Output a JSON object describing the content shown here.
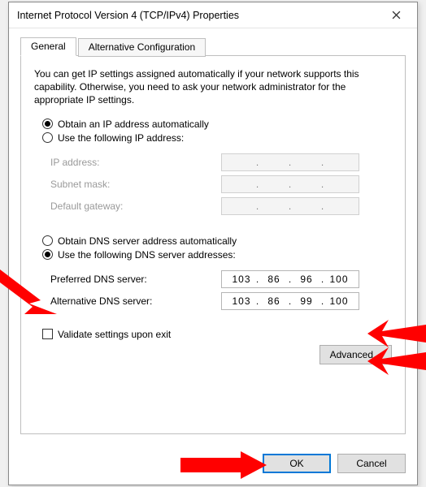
{
  "window": {
    "title": "Internet Protocol Version 4 (TCP/IPv4) Properties"
  },
  "tabs": {
    "general": "General",
    "alt": "Alternative Configuration"
  },
  "description": "You can get IP settings assigned automatically if your network supports this capability. Otherwise, you need to ask your network administrator for the appropriate IP settings.",
  "ip_section": {
    "auto_label": "Obtain an IP address automatically",
    "manual_label": "Use the following IP address:",
    "fields": {
      "ip_address": {
        "label": "IP address:",
        "value": ""
      },
      "subnet_mask": {
        "label": "Subnet mask:",
        "value": ""
      },
      "gateway": {
        "label": "Default gateway:",
        "value": ""
      }
    }
  },
  "dns_section": {
    "auto_label": "Obtain DNS server address automatically",
    "manual_label": "Use the following DNS server addresses:",
    "preferred": {
      "label": "Preferred DNS server:",
      "o1": "103",
      "o2": "86",
      "o3": "96",
      "o4": "100"
    },
    "alternate": {
      "label": "Alternative DNS server:",
      "o1": "103",
      "o2": "86",
      "o3": "99",
      "o4": "100"
    }
  },
  "validate_label": "Validate settings upon exit",
  "buttons": {
    "advanced": "Advanced...",
    "ok": "OK",
    "cancel": "Cancel"
  }
}
